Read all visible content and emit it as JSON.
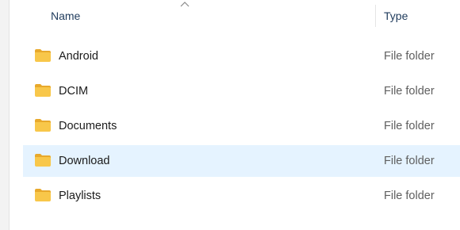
{
  "columns": {
    "name_label": "Name",
    "type_label": "Type",
    "sort_direction": "ascending"
  },
  "colors": {
    "folder": "#f8c74a",
    "folder_tab": "#e8a92c",
    "selected_row": "#e5f3ff"
  },
  "rows": [
    {
      "name": "Android",
      "type": "File folder",
      "icon": "folder-icon",
      "selected": false
    },
    {
      "name": "DCIM",
      "type": "File folder",
      "icon": "folder-icon",
      "selected": false
    },
    {
      "name": "Documents",
      "type": "File folder",
      "icon": "folder-icon",
      "selected": false
    },
    {
      "name": "Download",
      "type": "File folder",
      "icon": "folder-icon",
      "selected": true
    },
    {
      "name": "Playlists",
      "type": "File folder",
      "icon": "folder-icon",
      "selected": false
    }
  ]
}
